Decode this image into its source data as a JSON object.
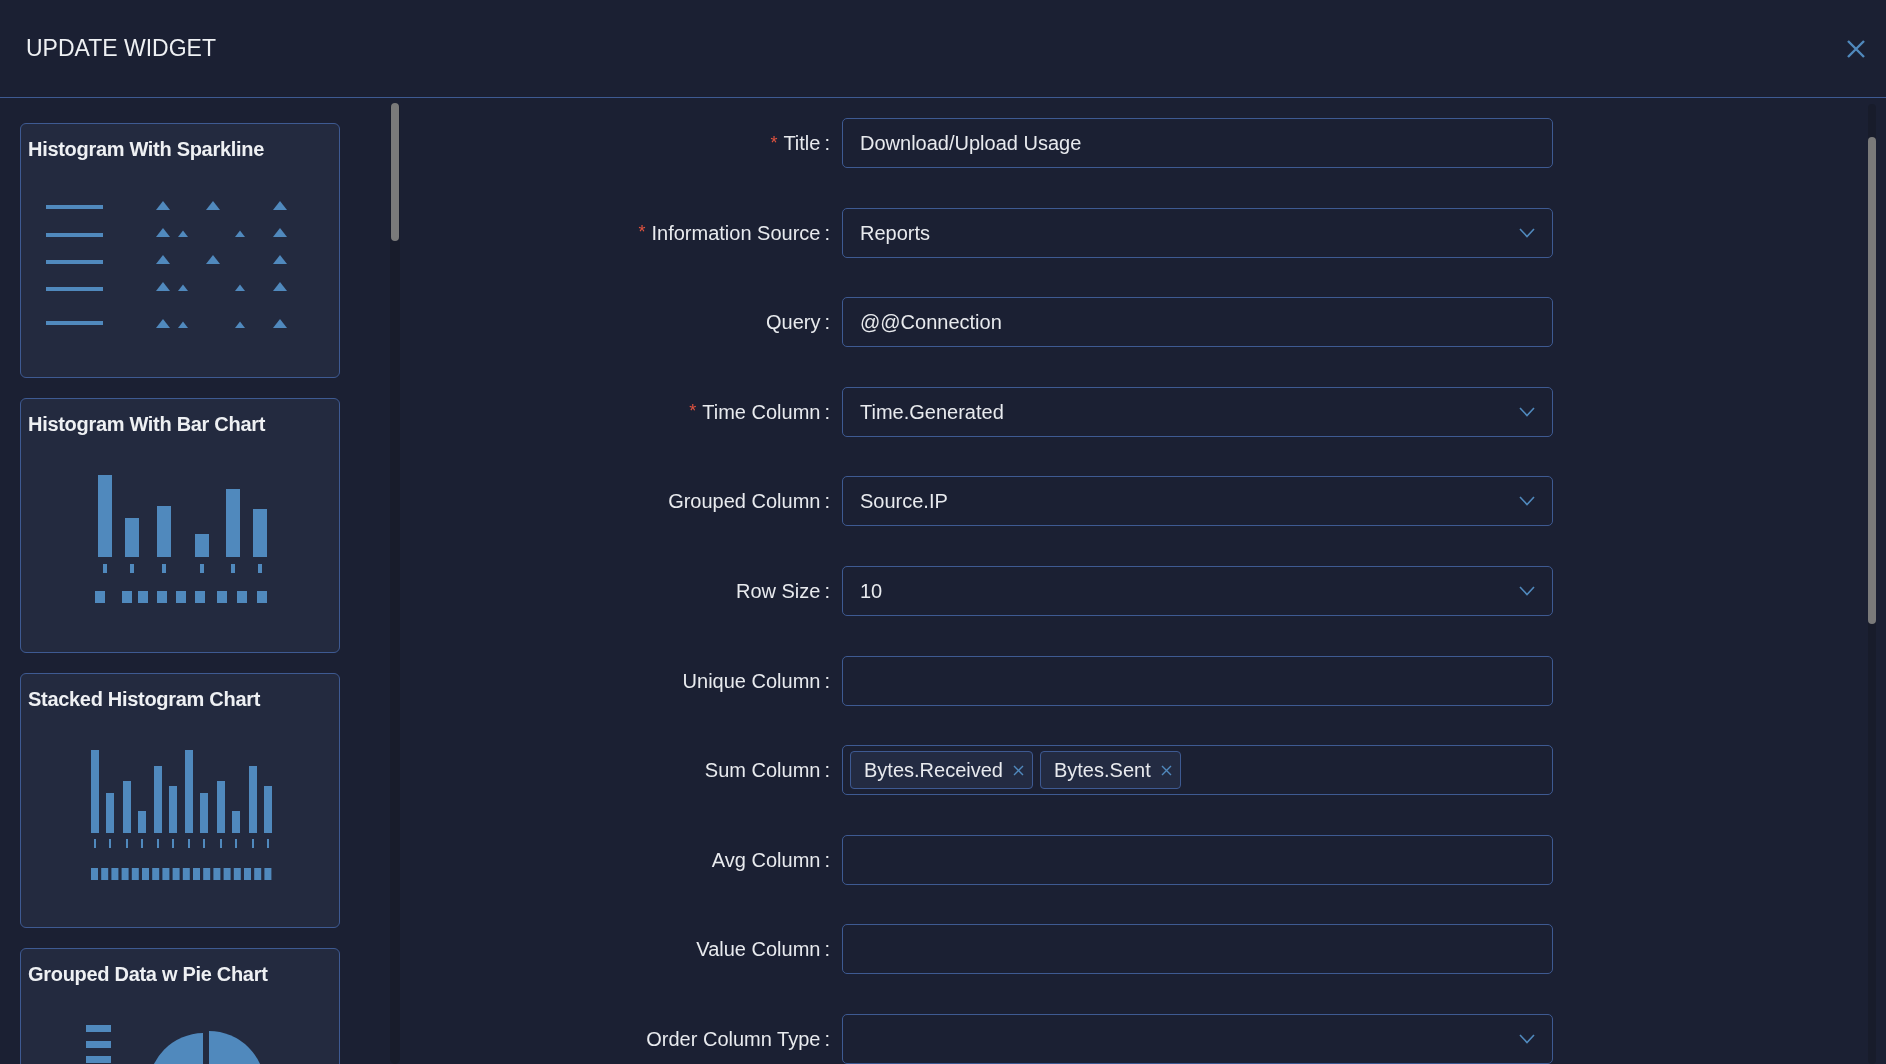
{
  "dialog": {
    "title": "UPDATE WIDGET"
  },
  "widget_types": [
    {
      "name": "Histogram With Sparkline",
      "kind": "sparkline"
    },
    {
      "name": "Histogram With Bar Chart",
      "kind": "bar"
    },
    {
      "name": "Stacked Histogram Chart",
      "kind": "stacked"
    },
    {
      "name": "Grouped Data w Pie Chart",
      "kind": "pie"
    }
  ],
  "form": {
    "fields": [
      {
        "required_mark": "*",
        "label": "Title",
        "colon": ":",
        "kind": "text",
        "value": "Download/Upload Usage"
      },
      {
        "required_mark": "*",
        "label": "Information Source",
        "colon": ":",
        "kind": "select",
        "value": "Reports"
      },
      {
        "label": "Query",
        "colon": ":",
        "kind": "text",
        "value": "@@Connection"
      },
      {
        "required_mark": "*",
        "label": "Time Column",
        "colon": ":",
        "kind": "select",
        "value": "Time.Generated"
      },
      {
        "label": "Grouped Column",
        "colon": ":",
        "kind": "select",
        "value": "Source.IP"
      },
      {
        "label": "Row Size",
        "colon": ":",
        "kind": "select",
        "value": "10"
      },
      {
        "label": "Unique Column",
        "colon": ":",
        "kind": "text"
      },
      {
        "label": "Sum Column",
        "colon": ":",
        "kind": "tags",
        "tags": [
          "Bytes.Received",
          "Bytes.Sent"
        ]
      },
      {
        "label": "Avg Column",
        "colon": ":",
        "kind": "text"
      },
      {
        "label": "Value Column",
        "colon": ":",
        "kind": "text"
      },
      {
        "label": "Order Column Type",
        "colon": ":",
        "kind": "select"
      }
    ]
  }
}
